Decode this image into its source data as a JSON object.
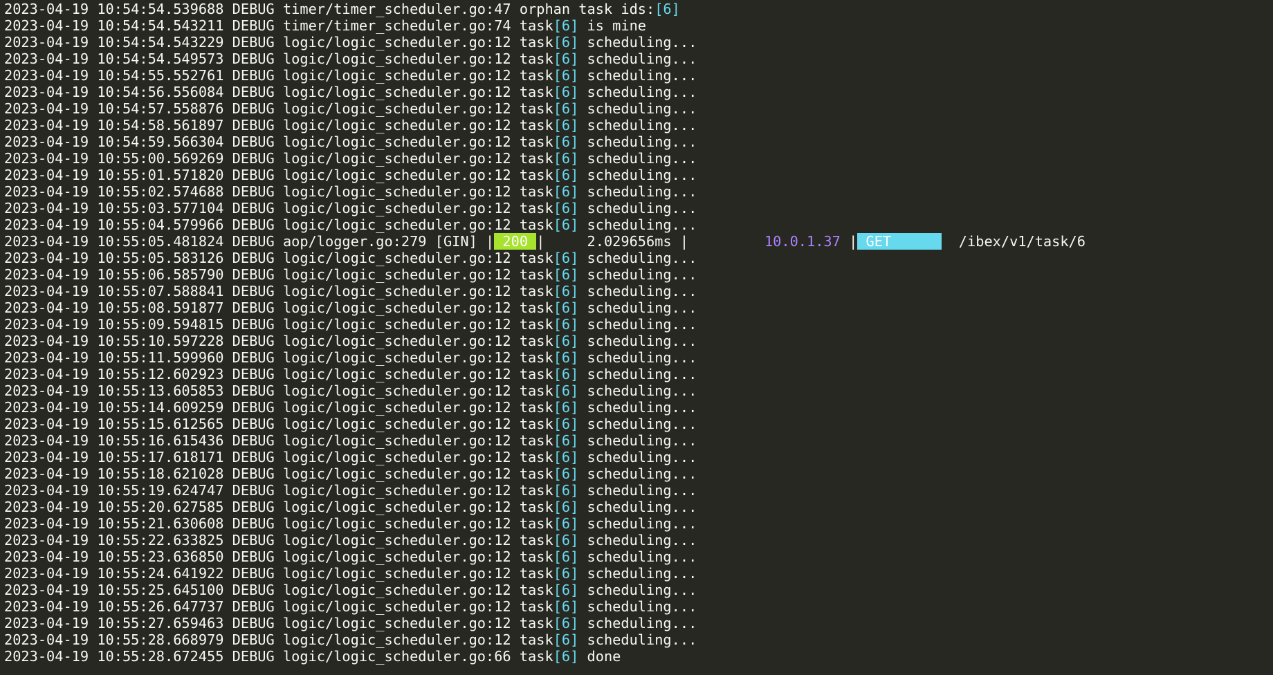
{
  "window": {
    "background": "#272822",
    "foreground": "#f8f8f2",
    "highlight_color": "#66d9ef",
    "status_bg": "#a6e22e",
    "ip_color": "#ae81ff",
    "method_bg": "#66d9ef"
  },
  "gin_line": {
    "prefix": "2023-04-19 10:55:05.481824 DEBUG aop/logger.go:279 [GIN] |",
    "status": " 200 ",
    "sep1": "|     2.029656ms |         ",
    "ip": "10.0.1.37",
    "sep2": " |",
    "method": " GET      ",
    "path": "  /ibex/v1/task/6"
  },
  "log_lines": [
    {
      "prefix": "2023-04-19 10:54:54.539688 DEBUG timer/timer_scheduler.go:47 orphan task ids:",
      "tag": "[6]",
      "suffix": ""
    },
    {
      "prefix": "2023-04-19 10:54:54.543211 DEBUG timer/timer_scheduler.go:74 task",
      "tag": "[6]",
      "suffix": " is mine"
    },
    {
      "prefix": "2023-04-19 10:54:54.543229 DEBUG logic/logic_scheduler.go:12 task",
      "tag": "[6]",
      "suffix": " scheduling..."
    },
    {
      "prefix": "2023-04-19 10:54:54.549573 DEBUG logic/logic_scheduler.go:12 task",
      "tag": "[6]",
      "suffix": " scheduling..."
    },
    {
      "prefix": "2023-04-19 10:54:55.552761 DEBUG logic/logic_scheduler.go:12 task",
      "tag": "[6]",
      "suffix": " scheduling..."
    },
    {
      "prefix": "2023-04-19 10:54:56.556084 DEBUG logic/logic_scheduler.go:12 task",
      "tag": "[6]",
      "suffix": " scheduling..."
    },
    {
      "prefix": "2023-04-19 10:54:57.558876 DEBUG logic/logic_scheduler.go:12 task",
      "tag": "[6]",
      "suffix": " scheduling..."
    },
    {
      "prefix": "2023-04-19 10:54:58.561897 DEBUG logic/logic_scheduler.go:12 task",
      "tag": "[6]",
      "suffix": " scheduling..."
    },
    {
      "prefix": "2023-04-19 10:54:59.566304 DEBUG logic/logic_scheduler.go:12 task",
      "tag": "[6]",
      "suffix": " scheduling..."
    },
    {
      "prefix": "2023-04-19 10:55:00.569269 DEBUG logic/logic_scheduler.go:12 task",
      "tag": "[6]",
      "suffix": " scheduling..."
    },
    {
      "prefix": "2023-04-19 10:55:01.571820 DEBUG logic/logic_scheduler.go:12 task",
      "tag": "[6]",
      "suffix": " scheduling..."
    },
    {
      "prefix": "2023-04-19 10:55:02.574688 DEBUG logic/logic_scheduler.go:12 task",
      "tag": "[6]",
      "suffix": " scheduling..."
    },
    {
      "prefix": "2023-04-19 10:55:03.577104 DEBUG logic/logic_scheduler.go:12 task",
      "tag": "[6]",
      "suffix": " scheduling..."
    },
    {
      "prefix": "2023-04-19 10:55:04.579966 DEBUG logic/logic_scheduler.go:12 task",
      "tag": "[6]",
      "suffix": " scheduling..."
    },
    {
      "gin": true
    },
    {
      "prefix": "2023-04-19 10:55:05.583126 DEBUG logic/logic_scheduler.go:12 task",
      "tag": "[6]",
      "suffix": " scheduling..."
    },
    {
      "prefix": "2023-04-19 10:55:06.585790 DEBUG logic/logic_scheduler.go:12 task",
      "tag": "[6]",
      "suffix": " scheduling..."
    },
    {
      "prefix": "2023-04-19 10:55:07.588841 DEBUG logic/logic_scheduler.go:12 task",
      "tag": "[6]",
      "suffix": " scheduling..."
    },
    {
      "prefix": "2023-04-19 10:55:08.591877 DEBUG logic/logic_scheduler.go:12 task",
      "tag": "[6]",
      "suffix": " scheduling..."
    },
    {
      "prefix": "2023-04-19 10:55:09.594815 DEBUG logic/logic_scheduler.go:12 task",
      "tag": "[6]",
      "suffix": " scheduling..."
    },
    {
      "prefix": "2023-04-19 10:55:10.597228 DEBUG logic/logic_scheduler.go:12 task",
      "tag": "[6]",
      "suffix": " scheduling..."
    },
    {
      "prefix": "2023-04-19 10:55:11.599960 DEBUG logic/logic_scheduler.go:12 task",
      "tag": "[6]",
      "suffix": " scheduling..."
    },
    {
      "prefix": "2023-04-19 10:55:12.602923 DEBUG logic/logic_scheduler.go:12 task",
      "tag": "[6]",
      "suffix": " scheduling..."
    },
    {
      "prefix": "2023-04-19 10:55:13.605853 DEBUG logic/logic_scheduler.go:12 task",
      "tag": "[6]",
      "suffix": " scheduling..."
    },
    {
      "prefix": "2023-04-19 10:55:14.609259 DEBUG logic/logic_scheduler.go:12 task",
      "tag": "[6]",
      "suffix": " scheduling..."
    },
    {
      "prefix": "2023-04-19 10:55:15.612565 DEBUG logic/logic_scheduler.go:12 task",
      "tag": "[6]",
      "suffix": " scheduling..."
    },
    {
      "prefix": "2023-04-19 10:55:16.615436 DEBUG logic/logic_scheduler.go:12 task",
      "tag": "[6]",
      "suffix": " scheduling..."
    },
    {
      "prefix": "2023-04-19 10:55:17.618171 DEBUG logic/logic_scheduler.go:12 task",
      "tag": "[6]",
      "suffix": " scheduling..."
    },
    {
      "prefix": "2023-04-19 10:55:18.621028 DEBUG logic/logic_scheduler.go:12 task",
      "tag": "[6]",
      "suffix": " scheduling..."
    },
    {
      "prefix": "2023-04-19 10:55:19.624747 DEBUG logic/logic_scheduler.go:12 task",
      "tag": "[6]",
      "suffix": " scheduling..."
    },
    {
      "prefix": "2023-04-19 10:55:20.627585 DEBUG logic/logic_scheduler.go:12 task",
      "tag": "[6]",
      "suffix": " scheduling..."
    },
    {
      "prefix": "2023-04-19 10:55:21.630608 DEBUG logic/logic_scheduler.go:12 task",
      "tag": "[6]",
      "suffix": " scheduling..."
    },
    {
      "prefix": "2023-04-19 10:55:22.633825 DEBUG logic/logic_scheduler.go:12 task",
      "tag": "[6]",
      "suffix": " scheduling..."
    },
    {
      "prefix": "2023-04-19 10:55:23.636850 DEBUG logic/logic_scheduler.go:12 task",
      "tag": "[6]",
      "suffix": " scheduling..."
    },
    {
      "prefix": "2023-04-19 10:55:24.641922 DEBUG logic/logic_scheduler.go:12 task",
      "tag": "[6]",
      "suffix": " scheduling..."
    },
    {
      "prefix": "2023-04-19 10:55:25.645100 DEBUG logic/logic_scheduler.go:12 task",
      "tag": "[6]",
      "suffix": " scheduling..."
    },
    {
      "prefix": "2023-04-19 10:55:26.647737 DEBUG logic/logic_scheduler.go:12 task",
      "tag": "[6]",
      "suffix": " scheduling..."
    },
    {
      "prefix": "2023-04-19 10:55:27.659463 DEBUG logic/logic_scheduler.go:12 task",
      "tag": "[6]",
      "suffix": " scheduling..."
    },
    {
      "prefix": "2023-04-19 10:55:28.668979 DEBUG logic/logic_scheduler.go:12 task",
      "tag": "[6]",
      "suffix": " scheduling..."
    },
    {
      "prefix": "2023-04-19 10:55:28.672455 DEBUG logic/logic_scheduler.go:66 task",
      "tag": "[6]",
      "suffix": " done"
    }
  ]
}
